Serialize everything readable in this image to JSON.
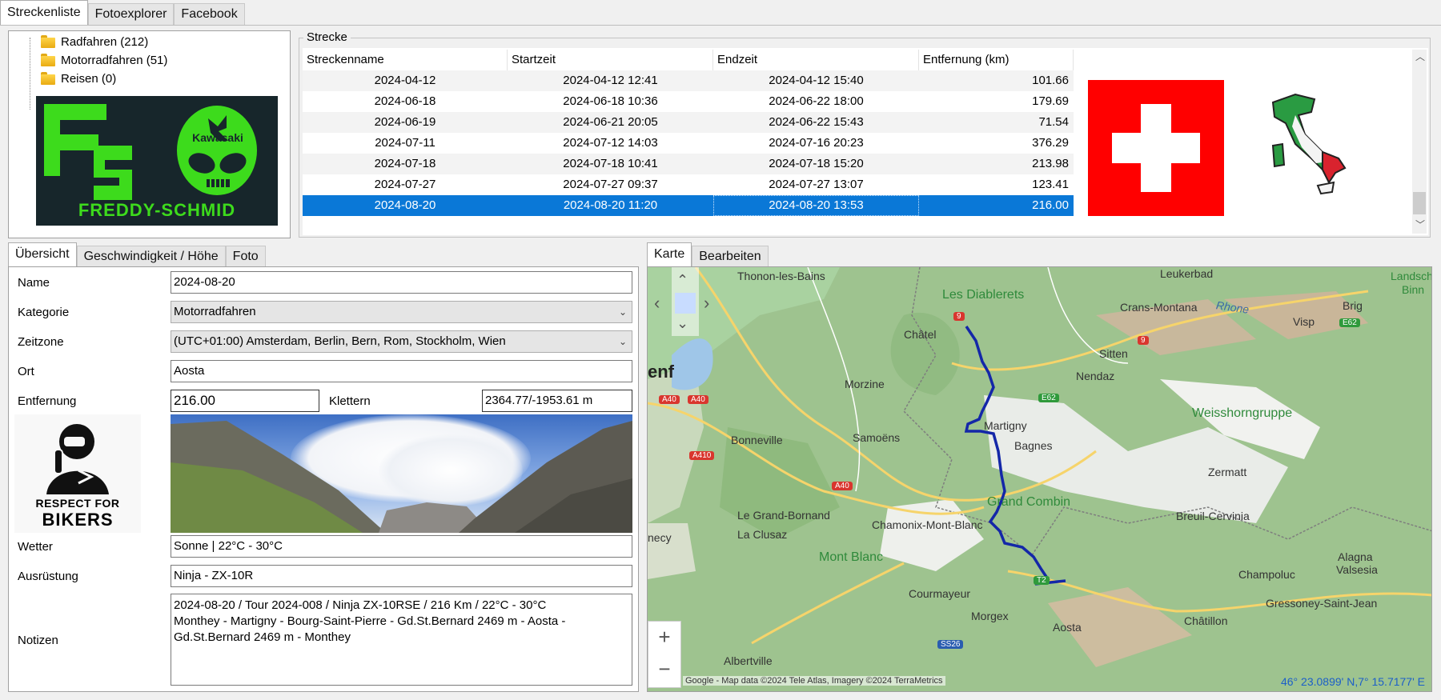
{
  "tabs": [
    "Streckenliste",
    "Fotoexplorer",
    "Facebook"
  ],
  "tree": {
    "items": [
      "Radfahren (212)",
      "Motorradfahren (51)",
      "Reisen (0)"
    ]
  },
  "logo": {
    "left_text": "FS",
    "brand": "Kawasaki",
    "bottom_text": "FREDDY-SCHMID",
    "color": "#3ddb1c"
  },
  "strecke": {
    "label": "Strecke",
    "columns": [
      "Streckenname",
      "Startzeit",
      "Endzeit",
      "Entfernung (km)"
    ],
    "rows": [
      [
        "2024-04-12",
        "2024-04-12 12:41",
        "2024-04-12 15:40",
        "101.66"
      ],
      [
        "2024-06-18",
        "2024-06-18 10:36",
        "2024-06-22 18:00",
        "179.69"
      ],
      [
        "2024-06-19",
        "2024-06-21 20:05",
        "2024-06-22 15:43",
        "71.54"
      ],
      [
        "2024-07-11",
        "2024-07-12 14:03",
        "2024-07-16 20:23",
        "376.29"
      ],
      [
        "2024-07-18",
        "2024-07-18 10:41",
        "2024-07-18 15:20",
        "213.98"
      ],
      [
        "2024-07-27",
        "2024-07-27 09:37",
        "2024-07-27 13:07",
        "123.41"
      ],
      [
        "2024-08-20",
        "2024-08-20 11:20",
        "2024-08-20 13:53",
        "216.00"
      ]
    ],
    "selected_index": 6
  },
  "detail_tabs": [
    "Übersicht",
    "Geschwindigkeit / Höhe",
    "Foto"
  ],
  "form": {
    "name_label": "Name",
    "name_value": "2024-08-20",
    "kategorie_label": "Kategorie",
    "kategorie_value": "Motorradfahren",
    "zeitzone_label": "Zeitzone",
    "zeitzone_value": "(UTC+01:00) Amsterdam, Berlin, Bern, Rom, Stockholm, Wien",
    "ort_label": "Ort",
    "ort_value": "Aosta",
    "entfernung_label": "Entfernung",
    "entfernung_value": "216.00",
    "klettern_label": "Klettern",
    "klettern_value": "2364.77/-1953.61 m",
    "wetter_label": "Wetter",
    "wetter_value": "Sonne | 22°C - 30°C",
    "ausruestung_label": "Ausrüstung",
    "ausruestung_value": "Ninja - ZX-10R",
    "notizen_label": "Notizen",
    "notizen_lines": [
      "2024-08-20 / Tour 2024-008 / Ninja ZX-10RSE / 216 Km / 22°C - 30°C",
      "Monthey - Martigny - Bourg-Saint-Pierre - Gd.St.Bernard 2469 m - Aosta -",
      "Gd.St.Bernard 2469 m - Monthey"
    ]
  },
  "sticker": {
    "line1": "RESPECT FOR",
    "line2": "BIKERS"
  },
  "map_tabs": [
    "Karte",
    "Bearbeiten"
  ],
  "map": {
    "places": [
      {
        "name": "Thonon-les-Bains"
      },
      {
        "name": "Les Diablerets"
      },
      {
        "name": "Leukerbad"
      },
      {
        "name": "Crans-Montana"
      },
      {
        "name": "Rhone"
      },
      {
        "name": "Brig"
      },
      {
        "name": "Visp"
      },
      {
        "name": "Châtel"
      },
      {
        "name": "Sitten"
      },
      {
        "name": "Nendaz"
      },
      {
        "name": "enf"
      },
      {
        "name": "Morzine"
      },
      {
        "name": "Martigny"
      },
      {
        "name": "Bagnes"
      },
      {
        "name": "Weisshorngruppe"
      },
      {
        "name": "Bonneville"
      },
      {
        "name": "Samoëns"
      },
      {
        "name": "Zermatt"
      },
      {
        "name": "Grand Combin"
      },
      {
        "name": "Le Grand-Bornand"
      },
      {
        "name": "Chamonix-Mont-Blanc"
      },
      {
        "name": "Breuil-Cervinia"
      },
      {
        "name": "necy"
      },
      {
        "name": "La Clusaz"
      },
      {
        "name": "Mont Blanc"
      },
      {
        "name": "Alagna"
      },
      {
        "name": "Valsesia"
      },
      {
        "name": "Champoluc"
      },
      {
        "name": "Courmayeur"
      },
      {
        "name": "Gressoney-Saint-Jean"
      },
      {
        "name": "Morgex"
      },
      {
        "name": "Châtillon"
      },
      {
        "name": "Aosta"
      },
      {
        "name": "Albertville"
      },
      {
        "name": "Landscha"
      },
      {
        "name": "Binn"
      }
    ],
    "road_badges": [
      "9",
      "9",
      "E62",
      "E62",
      "A40",
      "A40",
      "A410",
      "A40",
      "T2",
      "SS26"
    ],
    "attribution": "Google - Map data ©2024 Tele Atlas, Imagery ©2024 TerraMetrics",
    "coords": "46° 23.0899' N,7° 15.7177' E",
    "zoom_in": "+",
    "zoom_out": "−"
  }
}
